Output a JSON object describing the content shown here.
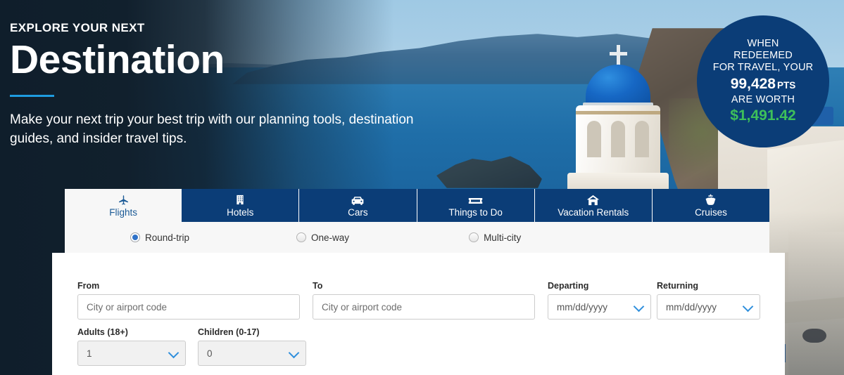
{
  "hero": {
    "eyebrow": "EXPLORE YOUR NEXT",
    "headline": "Destination",
    "subcopy": "Make your next trip your best trip with our planning tools, destination guides, and insider travel tips.",
    "accent_color": "#1e9ce0"
  },
  "badge": {
    "line1": "WHEN",
    "line2": "REDEEMED",
    "line3": "FOR TRAVEL, YOUR",
    "points": "99,428",
    "points_unit": "PTS",
    "line4": "ARE WORTH",
    "value": "$1,491.42",
    "bg_color": "#0b3d77",
    "value_color": "#3ec05a"
  },
  "tabs": [
    {
      "label": "Flights",
      "icon": "airplane-icon",
      "active": true
    },
    {
      "label": "Hotels",
      "icon": "building-icon",
      "active": false
    },
    {
      "label": "Cars",
      "icon": "car-icon",
      "active": false
    },
    {
      "label": "Things to Do",
      "icon": "ticket-icon",
      "active": false
    },
    {
      "label": "Vacation Rentals",
      "icon": "house-icon",
      "active": false
    },
    {
      "label": "Cruises",
      "icon": "ship-icon",
      "active": false
    }
  ],
  "trip_types": [
    {
      "label": "Round-trip",
      "selected": true
    },
    {
      "label": "One-way",
      "selected": false
    },
    {
      "label": "Multi-city",
      "selected": false
    }
  ],
  "form": {
    "from": {
      "label": "From",
      "value": "",
      "placeholder": "City or airport code"
    },
    "to": {
      "label": "To",
      "value": "",
      "placeholder": "City or airport code"
    },
    "departing": {
      "label": "Departing",
      "value": "mm/dd/yyyy"
    },
    "returning": {
      "label": "Returning",
      "value": "mm/dd/yyyy"
    },
    "adults": {
      "label": "Adults (18+)",
      "value": "1"
    },
    "children": {
      "label": "Children (0-17)",
      "value": "0"
    }
  }
}
